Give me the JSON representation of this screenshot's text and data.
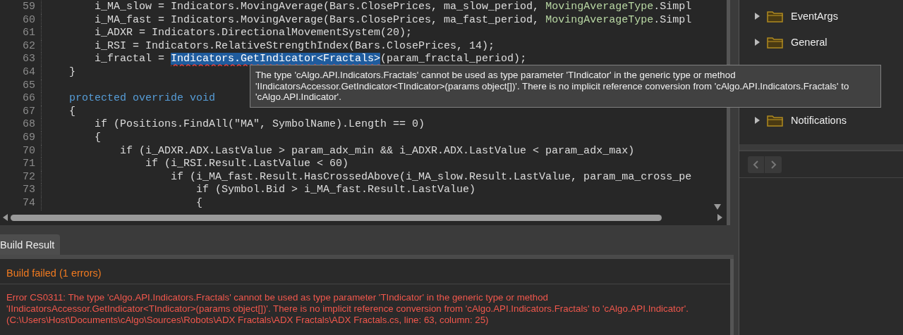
{
  "editor": {
    "lines": [
      {
        "number": "59",
        "tokens": [
          {
            "text": "        i_MA_slow = Indicators.MovingAverage(Bars.ClosePrices, ma_slow_period, ",
            "kind": "plain"
          },
          {
            "text": "MovingAverageType",
            "kind": "type"
          },
          {
            "text": ".Simpl",
            "kind": "plain"
          }
        ]
      },
      {
        "number": "60",
        "tokens": [
          {
            "text": "        i_MA_fast = Indicators.MovingAverage(Bars.ClosePrices, ma_fast_period, ",
            "kind": "plain"
          },
          {
            "text": "MovingAverageType",
            "kind": "type"
          },
          {
            "text": ".Simpl",
            "kind": "plain"
          }
        ]
      },
      {
        "number": "61",
        "tokens": [
          {
            "text": "        i_ADXR = Indicators.DirectionalMovementSystem(20);",
            "kind": "plain"
          }
        ]
      },
      {
        "number": "62",
        "tokens": [
          {
            "text": "        i_RSI = Indicators.RelativeStrengthIndex(Bars.ClosePrices, 14);",
            "kind": "plain"
          }
        ]
      },
      {
        "number": "63",
        "tokens": [
          {
            "text": "        i_fractal = ",
            "kind": "plain"
          },
          {
            "text": "Indicators.GetIndicator<Fractals>",
            "kind": "error-selected"
          },
          {
            "text": "(param_fractal_period);",
            "kind": "plain"
          }
        ]
      },
      {
        "number": "64",
        "tokens": [
          {
            "text": "    }",
            "kind": "plain"
          }
        ]
      },
      {
        "number": "65"
      },
      {
        "number": "66",
        "tokens": [
          {
            "text": "    protected override void",
            "kind": "keyword"
          }
        ]
      },
      {
        "number": "67",
        "tokens": [
          {
            "text": "    {",
            "kind": "plain"
          }
        ]
      },
      {
        "number": "68",
        "tokens": [
          {
            "text": "        if (Positions.FindAll(\"MA\", SymbolName).Length == 0)",
            "kind": "plain"
          }
        ]
      },
      {
        "number": "69",
        "tokens": [
          {
            "text": "        {",
            "kind": "plain"
          }
        ]
      },
      {
        "number": "70",
        "tokens": [
          {
            "text": "            if (i_ADXR.ADX.LastValue > param_adx_min && i_ADXR.ADX.LastValue < param_adx_max)",
            "kind": "plain"
          }
        ]
      },
      {
        "number": "71",
        "tokens": [
          {
            "text": "                if (i_RSI.Result.LastValue < 60)",
            "kind": "plain"
          }
        ]
      },
      {
        "number": "72",
        "tokens": [
          {
            "text": "                    if (i_MA_fast.Result.HasCrossedAbove(i_MA_slow.Result.LastValue, param_ma_cross_pe",
            "kind": "plain"
          }
        ]
      },
      {
        "number": "73",
        "tokens": [
          {
            "text": "                        if (Symbol.Bid > i_MA_fast.Result.LastValue)",
            "kind": "plain"
          }
        ]
      },
      {
        "number": "74",
        "tokens": [
          {
            "text": "                        {",
            "kind": "plain"
          }
        ]
      }
    ]
  },
  "tooltip": {
    "text": "The type 'cAlgo.API.Indicators.Fractals' cannot be used as type parameter 'TIndicator' in the generic type or method 'IIndicatorsAccessor.GetIndicator<TIndicator>(params object[])'. There is no implicit reference conversion from 'cAlgo.API.Indicators.Fractals' to 'cAlgo.API.Indicator'."
  },
  "tree": {
    "items": [
      {
        "label": "EventArgs",
        "expanded": false
      },
      {
        "label": "General",
        "expanded": false
      },
      {
        "label": "Notifications",
        "expanded": false
      }
    ]
  },
  "build": {
    "tabs": [
      {
        "label": "Build Result",
        "selected": true
      }
    ],
    "status": "Build failed (1 errors)",
    "errors": [
      "Error CS0311: The type 'cAlgo.API.Indicators.Fractals' cannot be used as type parameter 'TIndicator' in the generic type or method 'IIndicatorsAccessor.GetIndicator<TIndicator>(params object[])'. There is no implicit reference conversion from 'cAlgo.API.Indicators.Fractals' to 'cAlgo.API.Indicator'. (C:\\Users\\Host\\Documents\\cAlgo\\Sources\\Robots\\ADX Fractals\\ADX Fractals\\ADX Fractals.cs, line: 63, column: 25)"
    ]
  }
}
